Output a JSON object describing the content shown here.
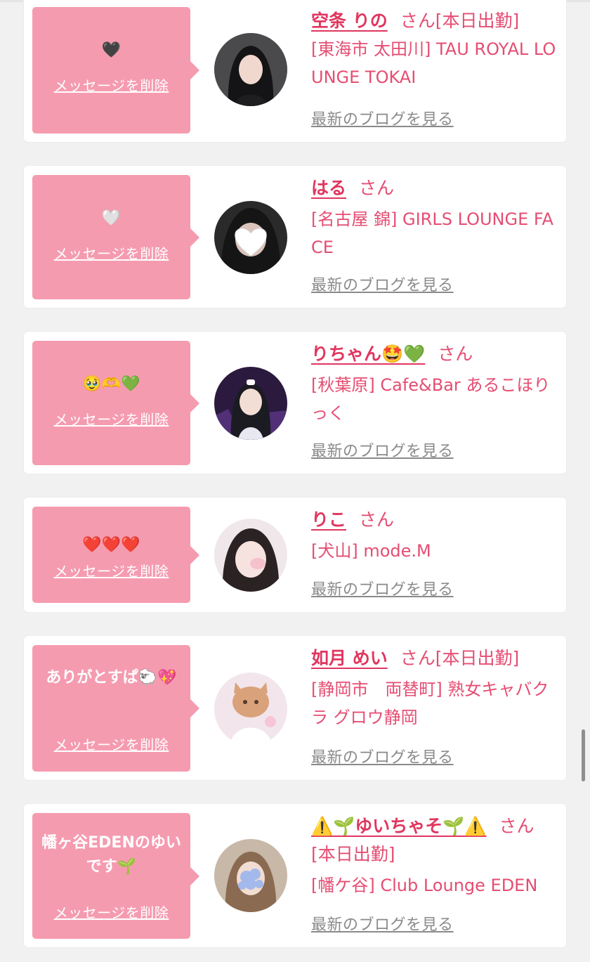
{
  "ui": {
    "delete_label": "メッセージを削除",
    "blog_label": "最新のブログを見る",
    "honorific": "さん"
  },
  "colors": {
    "background": "#f1f1f1",
    "bubble": "#f59bb0",
    "accent": "#e54d72",
    "link_gray": "#8a8a8a"
  },
  "entries": [
    {
      "message": "🖤",
      "name": "空条 りの",
      "status": "[本日出勤]",
      "shop": "[東海市 太田川] TAU ROYAL LOUNGE TOKAI",
      "avatar_desc": "avatar-photo"
    },
    {
      "message": "🤍",
      "name": "はる",
      "status": "",
      "shop": "[名古屋 錦] GIRLS LOUNGE FACE",
      "avatar_desc": "avatar-photo"
    },
    {
      "message": "🥹🫶💚",
      "name": "りちゃん🤩💚",
      "status": "",
      "shop": "[秋葉原] Cafe&Bar あるこほりっく",
      "avatar_desc": "avatar-photo"
    },
    {
      "message": "❤️❤️❤️",
      "name": "りこ",
      "status": "",
      "shop": "[犬山] mode.M",
      "avatar_desc": "avatar-photo"
    },
    {
      "message": "ありがとすぱ🐑💖",
      "name": "如月 めい",
      "status": "[本日出勤]",
      "shop": "[静岡市　両替町] 熟女キャバクラ グロウ静岡",
      "avatar_desc": "avatar-photo"
    },
    {
      "message": "幡ヶ谷EDENのゆいです🌱",
      "name": "⚠️🌱ゆいちゃそ🌱⚠️",
      "status": "[本日出勤]",
      "shop": "[幡ケ谷] Club Lounge EDEN",
      "avatar_desc": "avatar-photo"
    }
  ]
}
